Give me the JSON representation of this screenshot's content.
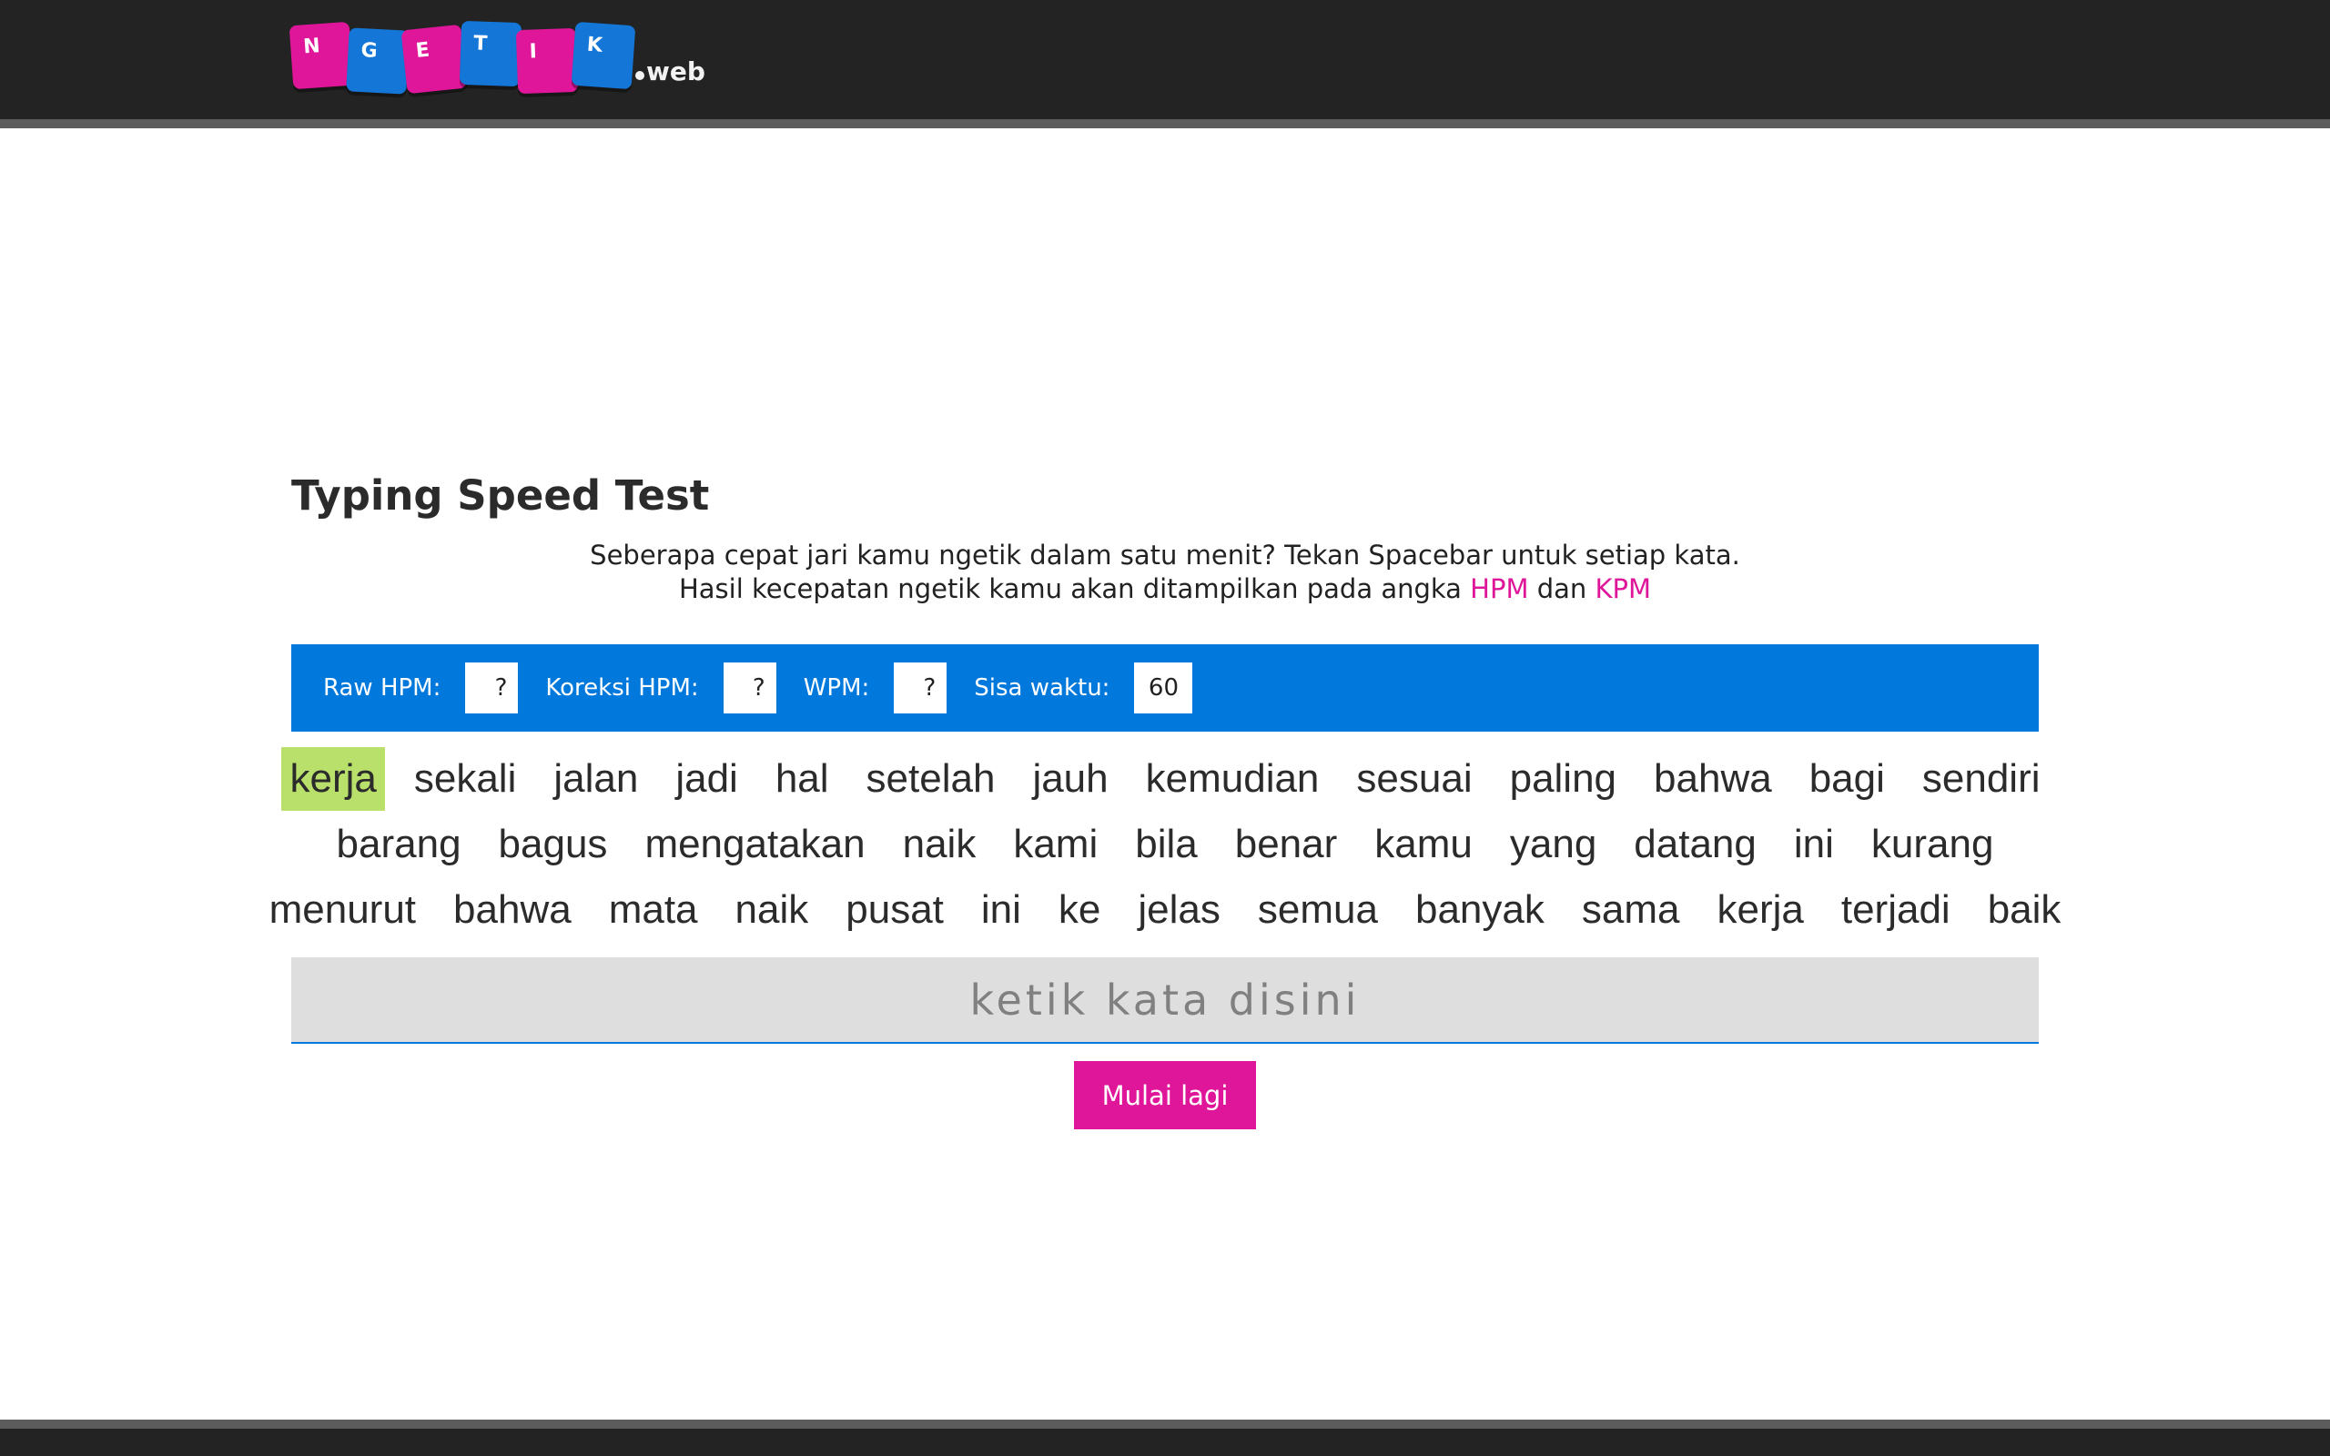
{
  "header": {
    "logo_keys": [
      "N",
      "G",
      "E",
      "T",
      "I",
      "K"
    ],
    "logo_suffix": "web"
  },
  "main": {
    "title": "Typing Speed Test",
    "intro_line1": "Seberapa cepat jari kamu ngetik dalam satu menit? Tekan Spacebar untuk setiap kata.",
    "intro_line2_prefix": "Hasil kecepatan ngetik kamu akan ditampilkan pada angka",
    "intro_hpm": "HPM",
    "intro_dan": "dan",
    "intro_kpm": "KPM"
  },
  "stats": {
    "raw_hpm_label": "Raw HPM:",
    "raw_hpm_value": "?",
    "koreksi_hpm_label": "Koreksi HPM:",
    "koreksi_hpm_value": "?",
    "wpm_label": "WPM:",
    "wpm_value": "?",
    "sisa_waktu_label": "Sisa waktu:",
    "sisa_waktu_value": "60"
  },
  "words": {
    "current_index": 0,
    "lines": [
      [
        "kerja",
        "sekali",
        "jalan",
        "jadi",
        "hal",
        "setelah",
        "jauh",
        "kemudian",
        "sesuai",
        "paling",
        "bahwa",
        "bagi",
        "sendiri"
      ],
      [
        "barang",
        "bagus",
        "mengatakan",
        "naik",
        "kami",
        "bila",
        "benar",
        "kamu",
        "yang",
        "datang",
        "ini",
        "kurang"
      ],
      [
        "menurut",
        "bahwa",
        "mata",
        "naik",
        "pusat",
        "ini",
        "ke",
        "jelas",
        "semua",
        "banyak",
        "sama",
        "kerja",
        "terjadi",
        "baik"
      ]
    ]
  },
  "input": {
    "placeholder": "ketik kata disini",
    "value": ""
  },
  "buttons": {
    "restart_label": "Mulai lagi"
  },
  "colors": {
    "accent_pink": "#e0169a",
    "accent_blue": "#0078dc",
    "highlight_green": "#b8e06a",
    "header_bg": "#232323"
  }
}
